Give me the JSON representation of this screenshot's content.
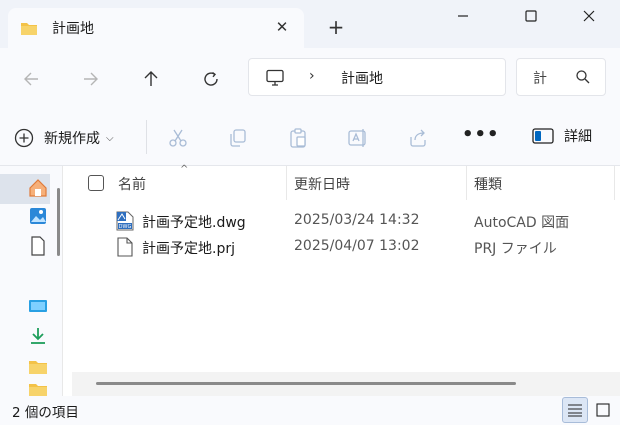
{
  "tab": {
    "title": "計画地",
    "close_glyph": "✕"
  },
  "new_tab_glyph": "+",
  "address": {
    "separator": "›",
    "crumb": "計画地"
  },
  "search": {
    "placeholder": "計"
  },
  "toolbar": {
    "new_label": "新規作成",
    "new_chevron": "⌵",
    "more_glyph": "•••",
    "details_label": "詳細"
  },
  "columns": {
    "name": "名前",
    "date": "更新日時",
    "type": "種類",
    "sort_glyph": "^"
  },
  "files": [
    {
      "name": "計画予定地.dwg",
      "date": "2025/03/24 14:32",
      "type": "AutoCAD 図面",
      "icon": "dwg-file-icon",
      "badge": "DWG"
    },
    {
      "name": "計画予定地.prj",
      "date": "2025/04/07 13:02",
      "type": "PRJ ファイル",
      "icon": "generic-file-icon"
    }
  ],
  "status": {
    "count": "2 個の項目"
  },
  "colors": {
    "accent": "#0067c0",
    "folder": "#f3c248",
    "chrome": "#f9fafd"
  }
}
